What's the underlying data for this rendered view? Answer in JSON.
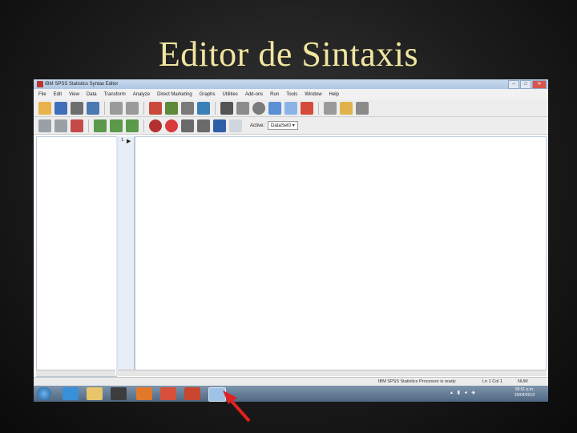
{
  "slide": {
    "title": "Editor de Sintaxis"
  },
  "window": {
    "title": "IBM SPSS Statistics Syntax Editor",
    "controls": {
      "minimize": "–",
      "maximize": "□",
      "close": "✕"
    }
  },
  "menu": [
    "File",
    "Edit",
    "View",
    "Data",
    "Transform",
    "Analyze",
    "Direct Marketing",
    "Graphs",
    "Utilities",
    "Add-ons",
    "Run",
    "Tools",
    "Window",
    "Help"
  ],
  "toolbar2": {
    "active_label": "Active:",
    "active_value": "DataSet0 ▾"
  },
  "editor": {
    "line_number": "1",
    "line_marker": "▶"
  },
  "status": {
    "processor": "IBM SPSS Statistics Processor is ready",
    "position": "Ln 1 Col 1",
    "num": "NUM"
  },
  "taskbar": {
    "tray_icons": "▴ ▮ ◂ ◈",
    "time": "09:51 p.m.",
    "date": "25/04/2013"
  },
  "colors": {
    "title": "#f0e6a0",
    "pointer": "#e02020",
    "titlebar": "#aec6e3",
    "taskbar": "#4f6781"
  },
  "icons": {
    "toolbar1": [
      "open-folder-icon",
      "save-icon",
      "print-icon",
      "dialog-recall-icon",
      "undo-icon",
      "redo-icon",
      "goto-case-icon",
      "goto-variable-icon",
      "variables-icon",
      "run-descriptives-icon",
      "find-icon",
      "run-selection-icon",
      "stop-icon",
      "select-cases-icon",
      "value-labels-icon",
      "use-variable-sets-icon",
      "show-all-variables-icon",
      "spell-check-icon",
      "script-icon"
    ],
    "toolbar2": [
      "bookmark-icon",
      "toggle-bookmark-icon",
      "comment-icon",
      "indent-icon",
      "outdent-icon",
      "uncomment-icon",
      "breakpoint-icon",
      "clear-breakpoint-icon",
      "validate-icon",
      "step-icon",
      "toggle-icon",
      "grid-icon"
    ],
    "taskbar": [
      "windows-start-icon",
      "internet-explorer-icon",
      "file-explorer-icon",
      "media-player-icon",
      "firefox-icon",
      "chrome-icon",
      "powerpoint-icon",
      "spss-icon"
    ]
  }
}
